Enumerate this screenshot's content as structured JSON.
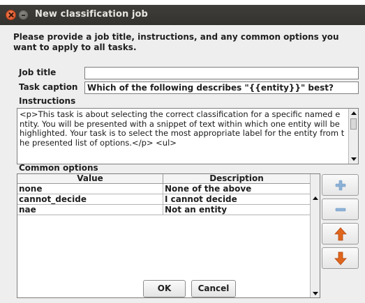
{
  "window": {
    "title": "New classification job"
  },
  "intro": "Please provide a job title, instructions, and any common options you want to apply to all tasks.",
  "form": {
    "job_title_label": "Job title",
    "job_title_value": "",
    "task_caption_label": "Task caption",
    "task_caption_value": "Which of the following describes \"{{entity}}\" best?",
    "instructions_label": "Instructions",
    "instructions_value": "<p>This task is about selecting the correct classification for a specific named entity.  You will be presented with a snippet of text within which one entity will be highlighted.  Your task is to select the most appropriate label for the entity from the presented list of options.</p>\n<ul>"
  },
  "options": {
    "label": "Common options",
    "columns": [
      "Value",
      "Description"
    ],
    "rows": [
      [
        "none",
        "None of the above"
      ],
      [
        "cannot_decide",
        "I cannot decide"
      ],
      [
        "nae",
        "Not an entity"
      ]
    ]
  },
  "buttons": {
    "ok": "OK",
    "cancel": "Cancel"
  },
  "colors": {
    "add_icon": "#8fb3d9",
    "remove_icon": "#8fb3d9",
    "move_icon": "#e0651d"
  }
}
